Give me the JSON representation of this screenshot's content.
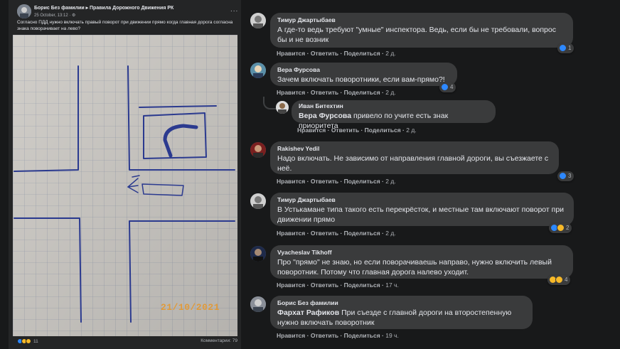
{
  "post": {
    "author": "Борис Без фамилии ▸ Правила Дорожного Движения РК",
    "meta": "25 October, 13:12 · ⚙",
    "more_label": "...",
    "text": "Согласно ПДД нужно включать правый поворот при движении прямо когда главная дорога согласна знака поворачивает на лево?",
    "photo_date": "21/10/2021",
    "reaction_count": "11",
    "comments_label": "Комментарии: 79"
  },
  "colors": {
    "like": "#2d88ff",
    "haha": "#f7b928",
    "love": "#f33e58",
    "bubble": "#3a3b3c",
    "background": "#18191a"
  },
  "comments": [
    {
      "author": "Тимур Джартыбаев",
      "text": "А где-то ведь требуют \"умные\" инспектора. Ведь, если бы не требовали, вопрос бы и не возник",
      "like": "Нравится",
      "reply": "Ответить",
      "share": "Поделиться",
      "time": "2 д.",
      "reactions": "1"
    },
    {
      "author": "Вера Фурсова",
      "text": "Зачем включать поворотники, если вам-прямо?!",
      "like": "Нравится",
      "reply": "Ответить",
      "share": "Поделиться",
      "time": "2 д.",
      "reactions": "4"
    },
    {
      "author": "Иван Битехтин",
      "mention": "Вера Фурсова",
      "text": "привело по учите есть знак приоритета",
      "like": "Нравится",
      "reply": "Ответить",
      "share": "Поделиться",
      "time": "2 д."
    },
    {
      "author": "Rakishev Yedil",
      "text": "Надо включать. Не зависимо от направления главной дороги, вы съезжаете с неё.",
      "like": "Нравится",
      "reply": "Ответить",
      "share": "Поделиться",
      "time": "2 д.",
      "reactions": "3"
    },
    {
      "author": "Тимур Джартыбаев",
      "text": "В Устькамане типа такого есть перекрёсток, и местные там включают поворот при движении прямо",
      "like": "Нравится",
      "reply": "Ответить",
      "share": "Поделиться",
      "time": "2 д.",
      "reactions": "2"
    },
    {
      "author": "Vyacheslav Tikhoff",
      "text": "Про \"прямо\" не знаю, но если поворачиваешь направо, нужно включить левый поворотник. Потому что главная дорога налево уходит.",
      "like": "Нравится",
      "reply": "Ответить",
      "share": "Поделиться",
      "time": "17 ч.",
      "reactions": "4"
    },
    {
      "author": "Борис Без фамилии",
      "mention": "Фархат Рафиков",
      "text": "При съезде с главной дороги на второстепенную нужно включать поворотник",
      "like": "Нравится",
      "reply": "Ответить",
      "share": "Поделиться",
      "time": "19 ч."
    }
  ]
}
